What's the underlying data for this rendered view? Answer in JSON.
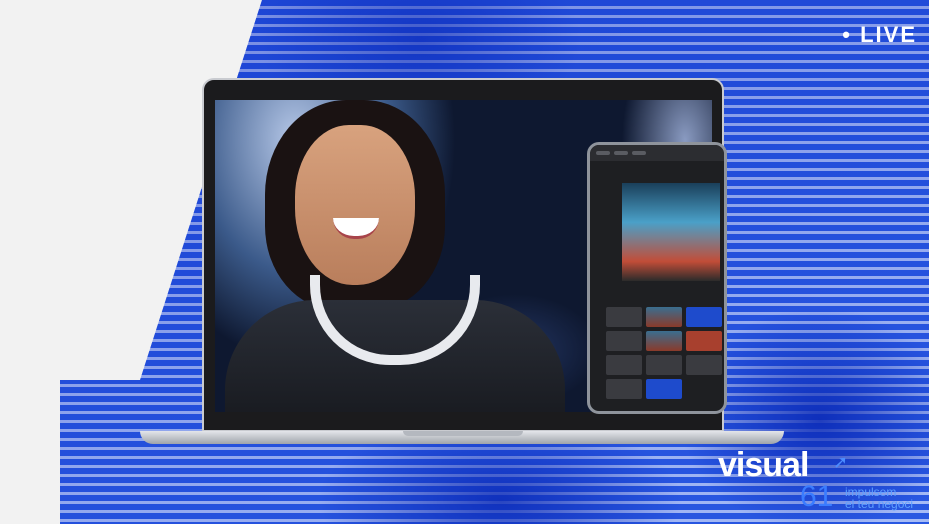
{
  "badge": {
    "live_label": "LIVE"
  },
  "brand": {
    "wordmark": "visual",
    "number": "61",
    "tagline_line1": "impulsem",
    "tagline_line2": "el teu negoci"
  },
  "colors": {
    "accent_blue": "#2a57e0",
    "logo_blue": "#3a7cff",
    "background_light": "#f2f2f2"
  },
  "icons": [
    "logo-arrow-icon"
  ]
}
